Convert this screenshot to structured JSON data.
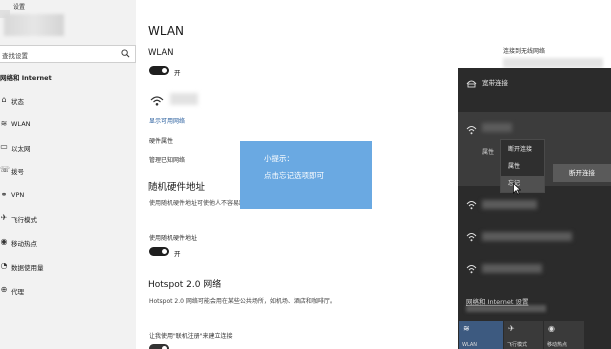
{
  "window": {
    "title": "设置"
  },
  "search": {
    "placeholder": "查找设置"
  },
  "sidebar": {
    "section_title": "网络和 Internet",
    "items": [
      {
        "label": "状态",
        "icon": "home-icon"
      },
      {
        "label": "WLAN",
        "icon": "wifi-icon"
      },
      {
        "label": "以太网",
        "icon": "ethernet-icon"
      },
      {
        "label": "拨号",
        "icon": "dialup-icon"
      },
      {
        "label": "VPN",
        "icon": "vpn-icon"
      },
      {
        "label": "飞行模式",
        "icon": "airplane-icon"
      },
      {
        "label": "移动热点",
        "icon": "hotspot-icon"
      },
      {
        "label": "数据使用量",
        "icon": "data-usage-icon"
      },
      {
        "label": "代理",
        "icon": "globe-icon"
      }
    ]
  },
  "main": {
    "title": "WLAN",
    "wlan_heading": "WLAN",
    "wlan_toggle_label": "开",
    "show_networks": "显示可用网络",
    "hardware_props": "硬件属性",
    "manage_known": "管理已知网络",
    "random_heading": "随机硬件地址",
    "random_desc": "使用随机硬件地址可使他人不容易跟踪你的位置。此设置适用于新连接。",
    "random_toggle_title": "使用随机硬件地址",
    "random_toggle_label": "开",
    "hotspot_heading": "Hotspot 2.0 网络",
    "hotspot_desc": "Hotspot 2.0 网络可能会用在某些公共场所，如机场、酒店和咖啡厅。",
    "hotspot_toggle_title": "让我使用\"联机注册\"来建立连接"
  },
  "tip": {
    "line1": "小提示：",
    "line2": "点击忘记选项即可"
  },
  "right": {
    "related_link": "连接到无线网络"
  },
  "flyout": {
    "broadband": "宽带连接",
    "properties": "属性",
    "disconnect_button": "断开连接",
    "settings_link": "网络和 Internet 设置",
    "tiles": [
      {
        "label": "WLAN",
        "icon": "wifi-icon"
      },
      {
        "label": "飞行模式",
        "icon": "airplane-icon"
      },
      {
        "label": "移动热点",
        "icon": "hotspot-icon"
      }
    ]
  },
  "context_menu": {
    "items": [
      "断开连接",
      "属性",
      "忘记"
    ],
    "hover_item": "忘记"
  },
  "colors": {
    "tip_bg": "#6aa9e2",
    "flyout_bg": "#2b2b2b",
    "link": "#2a5f9e"
  }
}
